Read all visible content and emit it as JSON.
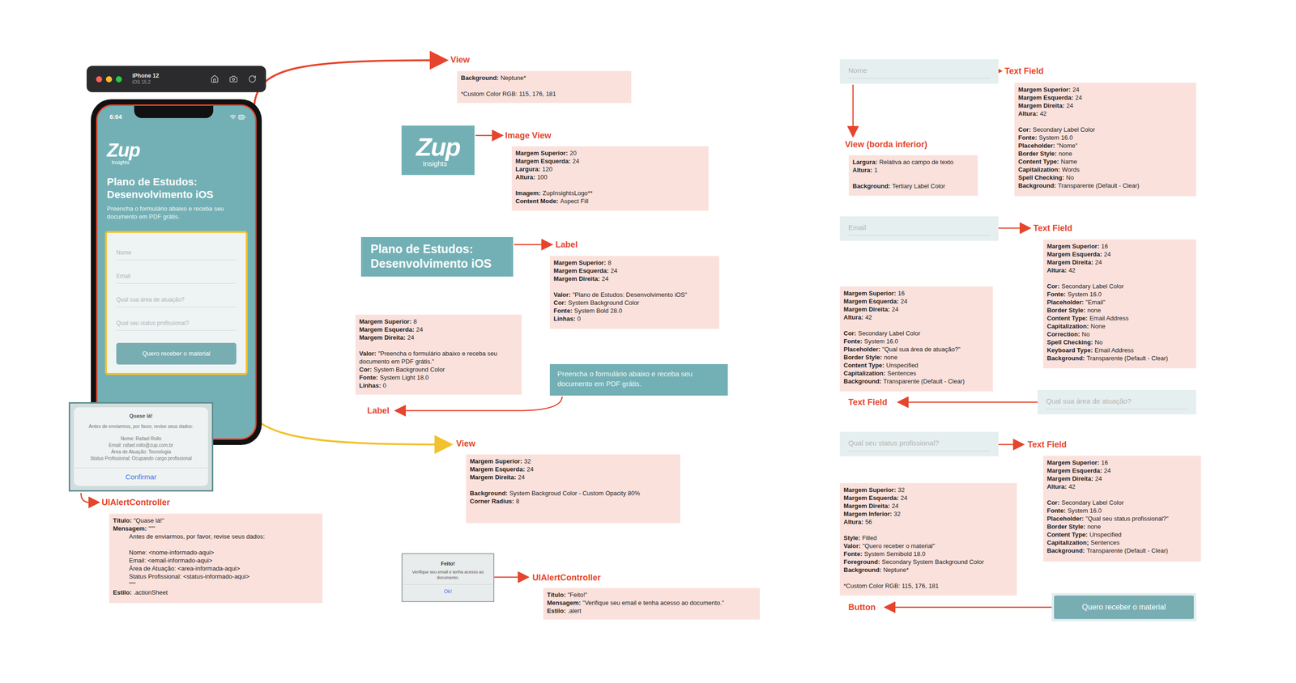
{
  "simulator": {
    "device": "iPhone 12",
    "os": "iOS 15.2"
  },
  "phone": {
    "time": "6:04",
    "logo": {
      "mark": "Zup",
      "sub": "Insights"
    },
    "title": "Plano de Estudos: Desenvolvimento iOS",
    "subtitle": "Preencha o formulário abaixo e receba seu documento em PDF grátis.",
    "fields": [
      "Nome",
      "Email",
      "Qual sua área de atuação?",
      "Qual seu status profissional?"
    ],
    "button": "Quero receber o material"
  },
  "alert_preview": {
    "title": "Quase lá!",
    "message": "Antes de enviarmos, por favor, revise seus dados:",
    "details": [
      "Nome: Rafael Rollo",
      "Email: rafael.rollo@zup.com.br",
      "Área de Atuação: Tecnologia",
      "Status Profissional: Ocupando cargo profissional"
    ],
    "action": "Confirmar"
  },
  "done_alert": {
    "title": "Feito!",
    "message": "Verifique seu email e tenha acesso ao documento.",
    "action": "Ok!"
  },
  "samples": {
    "logo": {
      "mark": "Zup",
      "sub": "Insights"
    },
    "title": "Plano de Estudos: Desenvolvimento iOS",
    "subtitle": "Preencha o formulário abaixo e receba seu documento em PDF grátis.",
    "fields": [
      "Nome",
      "Email",
      "Qual sua área de atuação?",
      "Qual seu status profissional?"
    ],
    "button": "Quero receber o material"
  },
  "annotations": [
    {
      "title": "View",
      "groups": [
        [
          {
            "key": "Background:",
            "value": "Neptune*",
            "kind": "plain"
          }
        ],
        [
          {
            "key": "",
            "value": "*Custom Color RGB: 115, 176, 181",
            "kind": "plain"
          }
        ]
      ]
    },
    {
      "title": "Image View",
      "groups": [
        [
          {
            "key": "Margem Superior:",
            "value": "20",
            "kind": "plain"
          },
          {
            "key": "Margem Esquerda:",
            "value": "24",
            "kind": "plain"
          },
          {
            "key": "Largura:",
            "value": "120",
            "kind": "plain"
          },
          {
            "key": "Altura:",
            "value": "100",
            "kind": "plain"
          }
        ],
        [
          {
            "key": "Imagem:",
            "value": "ZupInsightsLogo**",
            "kind": "plain"
          },
          {
            "key": "Content Mode:",
            "value": "Aspect Fill",
            "kind": "plain"
          }
        ]
      ]
    },
    {
      "title": "Label",
      "groups": [
        [
          {
            "key": "Margem Superior:",
            "value": "8",
            "kind": "plain"
          },
          {
            "key": "Margem Esquerda:",
            "value": "24",
            "kind": "plain"
          },
          {
            "key": "Margem Direita:",
            "value": "24",
            "kind": "plain"
          }
        ],
        [
          {
            "key": "Valor:",
            "value": "\"Plano de Estudos: Desenvolvimento iOS\"",
            "kind": "plain"
          },
          {
            "key": "Cor:",
            "value": "System Background Color",
            "kind": "plain"
          },
          {
            "key": "Fonte:",
            "value": "System Bold 28.0",
            "kind": "plain"
          },
          {
            "key": "Linhas:",
            "value": "0",
            "kind": "plain"
          }
        ]
      ]
    },
    {
      "title": "Label",
      "groups": [
        [
          {
            "key": "Margem Superior:",
            "value": "8",
            "kind": "plain"
          },
          {
            "key": "Margem Esquerda:",
            "value": "24",
            "kind": "plain"
          },
          {
            "key": "Margem Direita:",
            "value": "24",
            "kind": "plain"
          }
        ],
        [
          {
            "key": "Valor:",
            "value": "\"Preencha o formulário abaixo e receba seu documento em PDF grátis.\"",
            "kind": "plain"
          },
          {
            "key": "Cor:",
            "value": "System Background Color",
            "kind": "plain"
          },
          {
            "key": "Fonte:",
            "value": "System Light 18.0",
            "kind": "plain"
          },
          {
            "key": "Linhas:",
            "value": "0",
            "kind": "plain"
          }
        ]
      ]
    },
    {
      "title": "View",
      "groups": [
        [
          {
            "key": "Margem Superior:",
            "value": "32",
            "kind": "plain"
          },
          {
            "key": "Margem Esquerda:",
            "value": "24",
            "kind": "plain"
          },
          {
            "key": "Margem Direita:",
            "value": "24",
            "kind": "plain"
          }
        ],
        [
          {
            "key": "Background:",
            "value": "System Backgroud Color - Custom Opacity 80%",
            "kind": "plain"
          },
          {
            "key": "Corner Radius:",
            "value": "8",
            "kind": "plain"
          }
        ]
      ]
    },
    {
      "title": "UIAlertController",
      "groups": [
        [
          {
            "key": "Título:",
            "value": "\"Quase lá!\"",
            "kind": "plain"
          },
          {
            "key": "Mensagem:",
            "value": "\"\"\"",
            "kind": "plain"
          },
          {
            "key": "",
            "value": "Antes de enviarmos, por favor, revise seus dados:",
            "kind": "indented"
          }
        ],
        [
          {
            "key": "",
            "value": "Nome: <nome-informado-aqui>",
            "kind": "indented"
          },
          {
            "key": "",
            "value": "Email: <email-informado-aqui>",
            "kind": "indented"
          },
          {
            "key": "",
            "value": "Área de Atuação: <area-informada-aqui>",
            "kind": "indented"
          },
          {
            "key": "",
            "value": "Status Profissional: <status-informado-aqui>",
            "kind": "indented"
          },
          {
            "key": "",
            "value": "\"\"\"",
            "kind": "indented"
          },
          {
            "key": "Estilo:",
            "value": ".actionSheet",
            "kind": "plain"
          }
        ]
      ]
    },
    {
      "title": "UIAlertController",
      "groups": [
        [
          {
            "key": "Título:",
            "value": "\"Feito!\"",
            "kind": "plain"
          },
          {
            "key": "Mensagem:",
            "value": "\"Verifique seu email e tenha acesso ao documento.\"",
            "kind": "plain"
          },
          {
            "key": "Estilo:",
            "value": ".alert",
            "kind": "plain"
          }
        ]
      ]
    },
    {
      "title": "Text Field",
      "groups": [
        [
          {
            "key": "Margem Superior:",
            "value": "24",
            "kind": "plain"
          },
          {
            "key": "Margem Esquerda:",
            "value": "24",
            "kind": "plain"
          },
          {
            "key": "Margem Direita:",
            "value": "24",
            "kind": "plain"
          },
          {
            "key": "Altura:",
            "value": "42",
            "kind": "plain"
          }
        ],
        [
          {
            "key": "Cor:",
            "value": "Secondary Label Color",
            "kind": "plain"
          },
          {
            "key": "Fonte:",
            "value": "System 16.0",
            "kind": "plain"
          },
          {
            "key": "Placeholder:",
            "value": "\"Nome\"",
            "kind": "plain"
          },
          {
            "key": "Border Style:",
            "value": "none",
            "kind": "plain"
          },
          {
            "key": "Content Type:",
            "value": "Name",
            "kind": "plain"
          },
          {
            "key": "Capitalization:",
            "value": "Words",
            "kind": "plain"
          },
          {
            "key": "Spell Checking:",
            "value": "No",
            "kind": "plain"
          },
          {
            "key": "Background:",
            "value": "Transparente (Default - Clear)",
            "kind": "plain"
          }
        ]
      ]
    },
    {
      "title": "View (borda inferior)",
      "groups": [
        [
          {
            "key": "Largura:",
            "value": "Relativa ao campo de texto",
            "kind": "plain"
          },
          {
            "key": "Altura:",
            "value": "1",
            "kind": "plain"
          }
        ],
        [
          {
            "key": "Background:",
            "value": "Tertiary Label Color",
            "kind": "plain"
          }
        ]
      ]
    },
    {
      "title": "Text Field",
      "groups": [
        [
          {
            "key": "Margem Superior:",
            "value": "16",
            "kind": "plain"
          },
          {
            "key": "Margem Esquerda:",
            "value": "24",
            "kind": "plain"
          },
          {
            "key": "Margem Direita:",
            "value": "24",
            "kind": "plain"
          },
          {
            "key": "Altura:",
            "value": "42",
            "kind": "plain"
          }
        ],
        [
          {
            "key": "Cor:",
            "value": "Secondary Label Color",
            "kind": "plain"
          },
          {
            "key": "Fonte:",
            "value": "System 16.0",
            "kind": "plain"
          },
          {
            "key": "Placeholder:",
            "value": "\"Email\"",
            "kind": "plain"
          },
          {
            "key": "Border Style:",
            "value": "none",
            "kind": "plain"
          },
          {
            "key": "Content Type:",
            "value": "Email Address",
            "kind": "plain"
          },
          {
            "key": "Capitalization:",
            "value": "None",
            "kind": "plain"
          },
          {
            "key": "Correction:",
            "value": "No",
            "kind": "plain"
          },
          {
            "key": "Spell Checking:",
            "value": "No",
            "kind": "plain"
          },
          {
            "key": "Keyboard Type:",
            "value": "Email Address",
            "kind": "plain"
          },
          {
            "key": "Background:",
            "value": "Transparente (Default - Clear)",
            "kind": "plain"
          }
        ]
      ]
    },
    {
      "title": "Text Field",
      "groups": [
        [
          {
            "key": "Margem Superior:",
            "value": "16",
            "kind": "plain"
          },
          {
            "key": "Margem Esquerda:",
            "value": "24",
            "kind": "plain"
          },
          {
            "key": "Margem Direita:",
            "value": "24",
            "kind": "plain"
          },
          {
            "key": "Altura:",
            "value": "42",
            "kind": "plain"
          }
        ],
        [
          {
            "key": "Cor:",
            "value": "Secondary Label Color",
            "kind": "plain"
          },
          {
            "key": "Fonte:",
            "value": "System 16.0",
            "kind": "plain"
          },
          {
            "key": "Placeholder:",
            "value": "\"Qual sua área de atuação?\"",
            "kind": "plain"
          },
          {
            "key": "Border Style:",
            "value": "none",
            "kind": "plain"
          },
          {
            "key": "Content Type:",
            "value": "Unspecified",
            "kind": "plain"
          },
          {
            "key": "Capitalization:",
            "value": "Sentences",
            "kind": "plain"
          },
          {
            "key": "Background:",
            "value": "Transparente (Default - Clear)",
            "kind": "plain"
          }
        ]
      ]
    },
    {
      "title": "Text Field",
      "groups": [
        [
          {
            "key": "Margem Superior:",
            "value": "16",
            "kind": "plain"
          },
          {
            "key": "Margem Esquerda:",
            "value": "24",
            "kind": "plain"
          },
          {
            "key": "Margem Direita:",
            "value": "24",
            "kind": "plain"
          },
          {
            "key": "Altura:",
            "value": "42",
            "kind": "plain"
          }
        ],
        [
          {
            "key": "Cor:",
            "value": "Secondary Label Color",
            "kind": "plain"
          },
          {
            "key": "Fonte:",
            "value": "System 16.0",
            "kind": "plain"
          },
          {
            "key": "Placeholder:",
            "value": "\"Qual seu status profissional?\"",
            "kind": "plain"
          },
          {
            "key": "Border Style:",
            "value": "none",
            "kind": "plain"
          },
          {
            "key": "Content Type:",
            "value": "Unspecified",
            "kind": "plain"
          },
          {
            "key": "Capitalization;",
            "value": "Sentences",
            "kind": "plain"
          },
          {
            "key": "Background:",
            "value": "Transparente (Default - Clear)",
            "kind": "plain"
          }
        ]
      ]
    },
    {
      "title": "Button",
      "groups": [
        [
          {
            "key": "Margem Superior:",
            "value": "32",
            "kind": "plain"
          },
          {
            "key": "Margem Esquerda:",
            "value": "24",
            "kind": "plain"
          },
          {
            "key": "Margem Direita:",
            "value": "24",
            "kind": "plain"
          },
          {
            "key": "Margem Inferior:",
            "value": "32",
            "kind": "plain"
          },
          {
            "key": "Altura:",
            "value": "56",
            "kind": "plain"
          }
        ],
        [
          {
            "key": "Style:",
            "value": "Filled",
            "kind": "plain"
          },
          {
            "key": "Valor:",
            "value": "\"Quero receber o material\"",
            "kind": "plain"
          },
          {
            "key": "Fonte:",
            "value": "System Semibold 18.0",
            "kind": "plain"
          },
          {
            "key": "Foreground:",
            "value": "Secondary System Background Color",
            "kind": "plain"
          },
          {
            "key": "Background:",
            "value": "Neptune*",
            "kind": "plain"
          }
        ],
        [
          {
            "key": "",
            "value": "*Custom Color RGB: 115, 176, 181",
            "kind": "plain"
          }
        ]
      ]
    }
  ]
}
